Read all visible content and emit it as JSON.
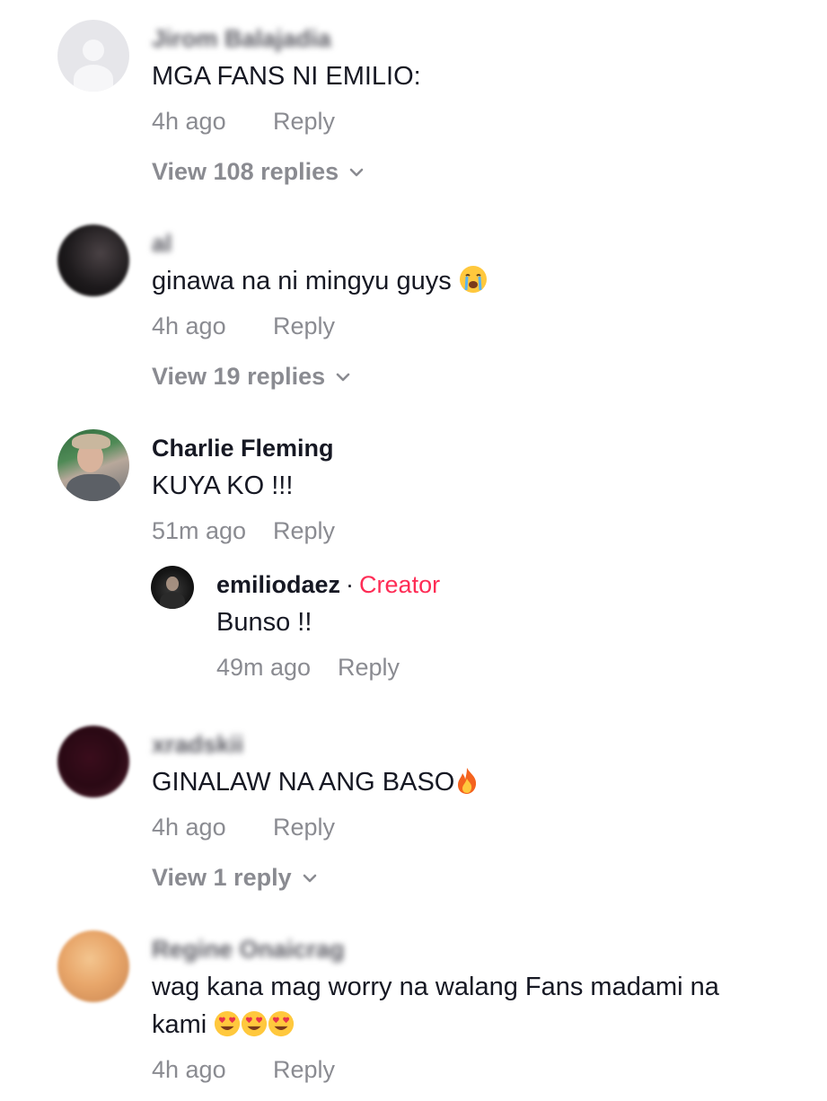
{
  "comments": [
    {
      "username": "Jirom Balajadia",
      "username_blurred": true,
      "text": "MGA FANS NI EMILIO:",
      "time": "4h ago",
      "reply_label": "Reply",
      "view_replies": "View 108 replies",
      "avatar": "default-user-icon"
    },
    {
      "username": "al",
      "username_blurred": true,
      "text": "ginawa na ni mingyu guys",
      "emoji": "loudly-crying-face-icon",
      "time": "4h ago",
      "reply_label": "Reply",
      "view_replies": "View 19 replies"
    },
    {
      "username": "Charlie Fleming",
      "username_blurred": false,
      "text": "KUYA KO !!!",
      "time": "51m ago",
      "reply_label": "Reply",
      "reply": {
        "username": "emiliodaez",
        "separator": "·",
        "badge": "Creator",
        "text": "Bunso !!",
        "time": "49m ago",
        "reply_label": "Reply"
      }
    },
    {
      "username": "xradskii",
      "username_blurred": true,
      "text": "GINALAW NA ANG BASO",
      "emoji": "fire-icon",
      "time": "4h ago",
      "reply_label": "Reply",
      "view_replies": "View 1 reply"
    },
    {
      "username": "Regine Onaicrag",
      "username_blurred": true,
      "text_line1": "wag kana mag worry na walang Fans madami na",
      "text_line2": "kami",
      "emoji": "smiling-face-with-heart-eyes-icon",
      "emoji_count": 3,
      "time": "4h ago",
      "reply_label": "Reply"
    }
  ],
  "colors": {
    "text": "#161823",
    "muted": "#8a8b91",
    "creator": "#fe2c55",
    "background": "#ffffff"
  }
}
